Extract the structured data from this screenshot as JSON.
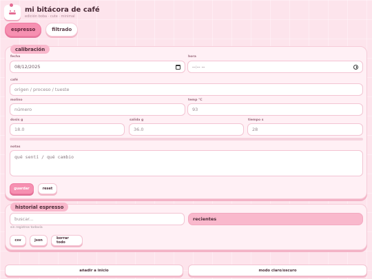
{
  "app": {
    "title": "mi bitácora de café",
    "subtitle": "edición boba · cute · minimal"
  },
  "tabs": [
    {
      "label": "espresso",
      "active": true
    },
    {
      "label": "filtrado",
      "active": false
    }
  ],
  "calibration": {
    "section_title": "calibración",
    "fecha": {
      "label": "fecha",
      "value": "08/12/2025"
    },
    "hora": {
      "label": "hora",
      "value": "--:-- --"
    },
    "cafe": {
      "label": "café",
      "placeholder": "origen / proceso / tueste"
    },
    "molino": {
      "label": "molino",
      "placeholder": "número"
    },
    "temp": {
      "label": "temp °C",
      "value": "93"
    },
    "dosis": {
      "label": "dosis g",
      "value": "18.0"
    },
    "salida": {
      "label": "salida g",
      "value": "36.0"
    },
    "tiempo": {
      "label": "tiempo s",
      "value": "28"
    },
    "notas": {
      "label": "notas",
      "placeholder": "qué sentí / qué cambio"
    },
    "save_label": "guardar",
    "reset_label": "reset"
  },
  "history": {
    "section_title": "historial espresso",
    "search_placeholder": "buscar...",
    "sort_value": "recientes",
    "empty_text": "sin registros todavía",
    "csv_label": "csv",
    "json_label": "json",
    "clear_label": "borrar todo"
  },
  "footer": {
    "home_label": "añadir a inicio",
    "theme_label": "modo claro/oscuro"
  },
  "colors": {
    "accent": "#f690b1",
    "background": "#fde4ec",
    "card": "#fff0f5"
  }
}
